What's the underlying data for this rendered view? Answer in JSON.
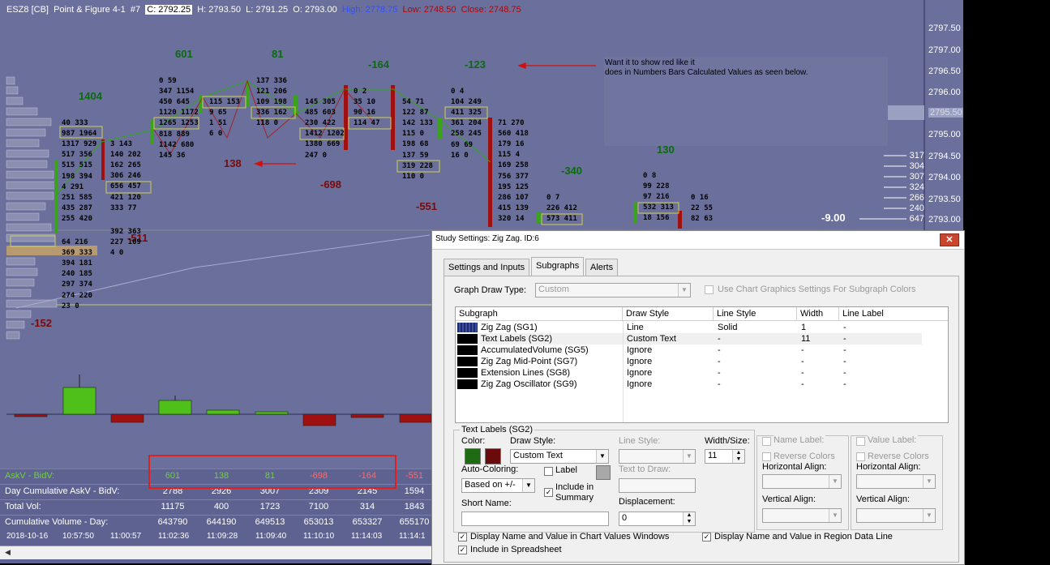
{
  "header": {
    "symbol": "ESZ8 [CB]",
    "chart_type": "Point & Figure 4-1",
    "chart_no": "#7",
    "c": "C: 2792.25",
    "h": "H: 2793.50",
    "l": "L: 2791.25",
    "o": "O: 2793.00",
    "high": "High: 2778.75",
    "low": "Low: 2748.50",
    "close": "Close: 2748.75"
  },
  "price_axis": [
    "2797.50",
    "2797.00",
    "2796.50",
    "2796.00",
    "2795.50",
    "2795.00",
    "2794.50",
    "2794.00",
    "2793.50",
    "2793.00"
  ],
  "right_labels": [
    "317",
    "304",
    "307",
    "324",
    "266",
    "240",
    "647"
  ],
  "zigzag_labels": {
    "g1404": "1404",
    "g601": "601",
    "g81": "81",
    "r164": "-164",
    "r123": "-123",
    "r138": "138",
    "r698": "-698",
    "r551": "-551",
    "r511": "-511",
    "r152": "-152",
    "r340": "-340",
    "g130": "130",
    "w900": "-9.00"
  },
  "annotation": {
    "line1": "Want it to show red like it",
    "line2": "does in Numbers Bars Calculated Values as seen below."
  },
  "pf_cells": {
    "c1": [
      "40 333",
      "987 1964",
      "1317 929",
      "517 356",
      "515 515",
      "198 394",
      "4 291",
      "251 585",
      "435 287",
      "255 420",
      "64 216",
      "369 333",
      "394 181",
      "240 185",
      "297 374",
      "274 220",
      "23 0"
    ],
    "c2": [
      "3 143",
      "140 202",
      "162 265",
      "306 246",
      "656 457",
      "421 120",
      "333 77",
      "392 363",
      "227 109",
      "4 0"
    ],
    "c3": [
      "0 59",
      "347 1154",
      "450 645",
      "1120 1172",
      "1265 1253",
      "818 889",
      "1142 680",
      "145 36"
    ],
    "c4": [
      "115 153",
      "9 65",
      "1 51",
      "6 0"
    ],
    "c5": [
      "137 336",
      "121 206",
      "109 198",
      "336 162",
      "118 0"
    ],
    "c6": [
      "145 305",
      "485 603",
      "230 422",
      "1412 1202",
      "1380 669",
      "247 0"
    ],
    "c7": [
      "0 2",
      "35 10",
      "90 16",
      "114 47"
    ],
    "c8": [
      "54 71",
      "122 87",
      "142 133",
      "115 0",
      "198 68",
      "137 59",
      "319 228",
      "110 0"
    ],
    "c9": [
      "0 4",
      "104 249",
      "411 325",
      "361 204",
      "258 245",
      "69 69",
      "16 0"
    ],
    "c10": [
      "71 270",
      "560 418",
      "179 16",
      "115 4",
      "169 258",
      "756 377",
      "195 125",
      "286 107",
      "415 139",
      "320 14"
    ],
    "c11": [
      "0 7",
      "226 412",
      "573 411"
    ],
    "c12": [
      "0 8",
      "99 228",
      "97 216",
      "532 313",
      "18 156"
    ],
    "c13": [
      "0 16",
      "22 55",
      "82 63"
    ]
  },
  "bottom_table": {
    "rows": [
      {
        "label": "AskV - BidV:",
        "cells": [
          "601",
          "138",
          "81",
          "-698",
          "-164",
          "-551"
        ]
      },
      {
        "label": "Day Cumulative AskV - BidV:",
        "cells": [
          "2788",
          "2926",
          "3007",
          "2309",
          "2145",
          "1594"
        ]
      },
      {
        "label": "Total Vol:",
        "cells": [
          "11175",
          "400",
          "1723",
          "7100",
          "314",
          "1843"
        ]
      },
      {
        "label": "Cumulative Volume - Day:",
        "cells": [
          "643790",
          "644190",
          "649513",
          "653013",
          "653327",
          "655170"
        ]
      }
    ],
    "times": [
      "2018-10-16",
      "10:57:50",
      "11:00:57",
      "11:02:36",
      "11:09:28",
      "11:09:40",
      "11:10:10",
      "11:14:03",
      "11:14:1"
    ]
  },
  "dialog": {
    "title": "Study Settings: Zig Zag. ID:6",
    "tabs": [
      "Settings and Inputs",
      "Subgraphs",
      "Alerts"
    ],
    "graph_draw_type_label": "Graph Draw Type:",
    "graph_draw_type_value": "Custom",
    "use_chart_graphics": "Use Chart Graphics Settings For Subgraph Colors",
    "grid_headers": [
      "Subgraph",
      "Draw Style",
      "Line Style",
      "Width",
      "Line Label"
    ],
    "grid_rows": [
      {
        "name": "Zig Zag (SG1)",
        "draw": "Line",
        "line": "Solid",
        "width": "1",
        "label": "-"
      },
      {
        "name": "Text Labels (SG2)",
        "draw": "Custom Text",
        "line": "-",
        "width": "11",
        "label": "-"
      },
      {
        "name": "AccumulatedVolume (SG5)",
        "draw": "Ignore",
        "line": "-",
        "width": "-",
        "label": "-"
      },
      {
        "name": "Zig Zag Mid-Point (SG7)",
        "draw": "Ignore",
        "line": "-",
        "width": "-",
        "label": "-"
      },
      {
        "name": "Extension Lines (SG8)",
        "draw": "Ignore",
        "line": "-",
        "width": "-",
        "label": "-"
      },
      {
        "name": "Zig Zag Oscillator (SG9)",
        "draw": "Ignore",
        "line": "-",
        "width": "-",
        "label": "-"
      }
    ],
    "group_title": "Text Labels (SG2)",
    "color_label": "Color:",
    "draw_style_label": "Draw Style:",
    "draw_style_value": "Custom Text",
    "line_style_label": "Line Style:",
    "width_size_label": "Width/Size:",
    "width_size_value": "11",
    "auto_coloring_label": "Auto-Coloring:",
    "label_chk": "Label",
    "auto_coloring_value": "Based on +/-",
    "include_summary": "Include in Summary",
    "text_to_draw_label": "Text to Draw:",
    "short_name_label": "Short Name:",
    "displacement_label": "Displacement:",
    "displacement_value": "0",
    "name_label": "Name Label:",
    "value_label": "Value Label:",
    "reverse_colors": "Reverse Colors",
    "horizontal_align": "Horizontal Align:",
    "vertical_align": "Vertical Align:",
    "display_name_value": "Display Name and Value in Chart Values Windows",
    "display_region": "Display Name and Value in Region Data Line",
    "include_spreadsheet": "Include in Spreadsheet"
  },
  "colors": {
    "chart_bg": "#6a6f9b",
    "up_green": "#2f8a1e",
    "down_red": "#8b1010",
    "label_green": "#0b6a10",
    "label_red": "#7a0a0a",
    "swatch_green": "#1f6b14",
    "swatch_red": "#6b0a0a"
  }
}
